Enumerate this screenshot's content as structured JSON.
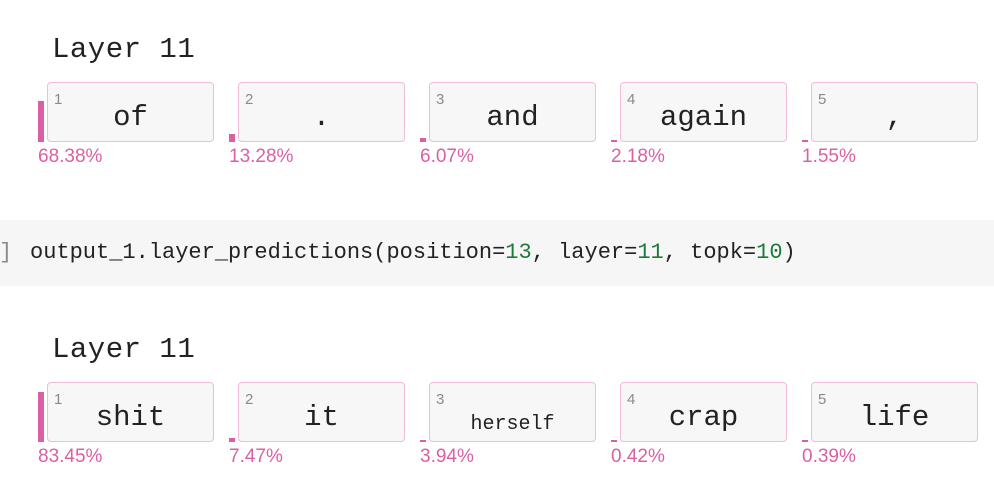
{
  "sections": [
    {
      "title": "Layer 11",
      "tokens": [
        {
          "rank": "1",
          "word": "of",
          "pct": "68.38%",
          "prob": 0.6838
        },
        {
          "rank": "2",
          "word": ".",
          "pct": "13.28%",
          "prob": 0.1328
        },
        {
          "rank": "3",
          "word": "and",
          "pct": "6.07%",
          "prob": 0.0607
        },
        {
          "rank": "4",
          "word": "again",
          "pct": "2.18%",
          "prob": 0.0218
        },
        {
          "rank": "5",
          "word": ",",
          "pct": "1.55%",
          "prob": 0.0155
        }
      ]
    },
    {
      "title": "Layer 11",
      "tokens": [
        {
          "rank": "1",
          "word": "shit",
          "pct": "83.45%",
          "prob": 0.8345
        },
        {
          "rank": "2",
          "word": "it",
          "pct": "7.47%",
          "prob": 0.0747
        },
        {
          "rank": "3",
          "word": "herself",
          "pct": "3.94%",
          "prob": 0.0394
        },
        {
          "rank": "4",
          "word": "crap",
          "pct": "0.42%",
          "prob": 0.0042
        },
        {
          "rank": "5",
          "word": "life",
          "pct": "0.39%",
          "prob": 0.0039
        }
      ]
    }
  ],
  "code": {
    "bracket": "]",
    "prefix": "output_1.layer_predictions(position=",
    "position": "13",
    "mid1": ", layer=",
    "layer": "11",
    "mid2": ", topk=",
    "topk": "10",
    "suffix": ")"
  },
  "colors": {
    "accent": "#db5fa4",
    "box_border": "#f0bcd7",
    "box_fill": "#f7f7f7",
    "code_band": "#f6f6f6",
    "number": "#1f7a3a"
  }
}
